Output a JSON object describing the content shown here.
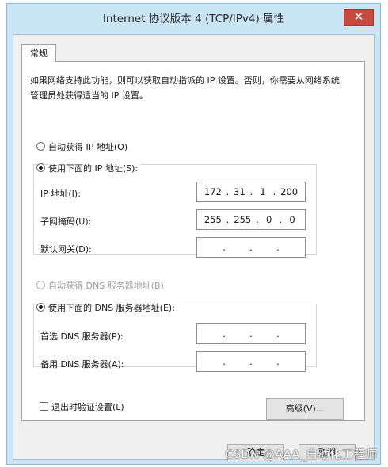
{
  "window": {
    "title": "Internet 协议版本 4 (TCP/IPv4) 属性",
    "close_glyph": "✕"
  },
  "tabs": [
    {
      "label": "常规"
    }
  ],
  "description": "如果网络支持此功能，则可以获取自动指派的 IP 设置。否则，你需要从网络系统管理员处获得适当的 IP 设置。",
  "ip_section": {
    "auto_option": "自动获得 IP 地址(O)",
    "manual_option": "使用下面的 IP 地址(S):",
    "selected": "manual",
    "fields": [
      {
        "label": "IP 地址(I):",
        "octets": [
          "172",
          "31",
          "1",
          "200"
        ]
      },
      {
        "label": "子网掩码(U):",
        "octets": [
          "255",
          "255",
          "0",
          "0"
        ]
      },
      {
        "label": "默认网关(D):",
        "octets": [
          "",
          "",
          "",
          ""
        ]
      }
    ]
  },
  "dns_section": {
    "auto_option": "自动获得 DNS 服务器地址(B)",
    "manual_option": "使用下面的 DNS 服务器地址(E):",
    "selected": "manual",
    "fields": [
      {
        "label": "首选 DNS 服务器(P):",
        "octets": [
          "",
          "",
          "",
          ""
        ]
      },
      {
        "label": "备用 DNS 服务器(A):",
        "octets": [
          "",
          "",
          "",
          ""
        ]
      }
    ]
  },
  "validate_checkbox": {
    "label": "退出时验证设置(L)",
    "checked": false
  },
  "advanced_button": {
    "label": "高级(V)..."
  },
  "ok_button": {
    "label": "确定"
  },
  "cancel_button": {
    "label": "取消"
  },
  "watermark": "CSDN @AAA_自动化工程师",
  "colors": {
    "title_bar": "#c9e5f6",
    "close_button": "#c84a3f"
  }
}
